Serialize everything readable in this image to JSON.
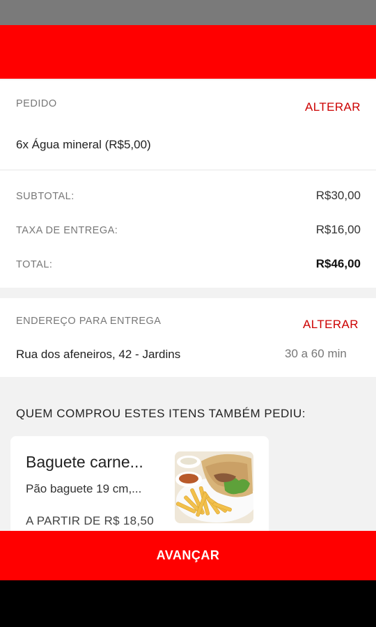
{
  "order": {
    "label": "PEDIDO",
    "change_label": "ALTERAR",
    "item_text": "6x Água mineral (R$5,00)"
  },
  "totals": {
    "subtotal_label": "SUBTOTAL:",
    "subtotal_value": "R$30,00",
    "delivery_fee_label": "TAXA DE ENTREGA:",
    "delivery_fee_value": "R$16,00",
    "total_label": "TOTAL:",
    "total_value": "R$46,00"
  },
  "delivery": {
    "label": "ENDEREÇO PARA ENTREGA",
    "change_label": "ALTERAR",
    "address": "Rua dos afeneiros, 42 - Jardins",
    "eta": "30 a 60 min"
  },
  "suggestions": {
    "title": "QUEM COMPROU ESTES ITENS TAMBÉM PEDIU:",
    "items": [
      {
        "name": "Baguete carne...",
        "description": "Pão baguete 19 cm,...",
        "price": "A PARTIR DE R$ 18,50",
        "image_icon": "sandwich-fries-photo"
      }
    ]
  },
  "footer": {
    "advance_label": "AVANÇAR"
  },
  "colors": {
    "brand_red": "#ff0000",
    "link_red": "#cc0000",
    "status_bar": "#7a7a7a",
    "background": "#f2f2f2"
  }
}
